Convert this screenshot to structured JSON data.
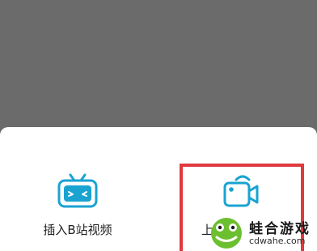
{
  "sheet": {
    "actions": [
      {
        "label": "插入B站视频",
        "icon": "bilibili-tv-icon"
      },
      {
        "label": "上",
        "icon": "video-camera-icon"
      }
    ]
  },
  "colors": {
    "accent": "#1aa3d1",
    "highlight": "#e0393e",
    "dim_overlay": "#6b6b6b"
  },
  "watermark": {
    "title": "蛙合游戏",
    "url": "cdwahe.com"
  }
}
